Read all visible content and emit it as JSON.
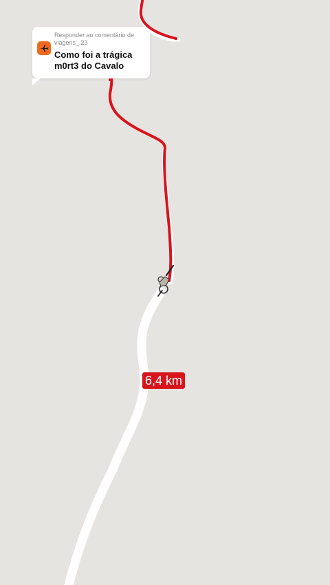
{
  "reply": {
    "meta": "Responder ao comentário de viagens_.23",
    "title": "Como foi a trágica\nm0rt3 do Cavalo",
    "avatar_icon": "airplane-icon",
    "avatar_color": "#ef6a1f"
  },
  "route": {
    "distance_label": "6,4 km",
    "traveled_color": "#d8141d",
    "remaining_color": "#ffffff",
    "rider_icon": "cyclist-icon"
  },
  "map": {
    "background_color": "#e6e4e1"
  }
}
